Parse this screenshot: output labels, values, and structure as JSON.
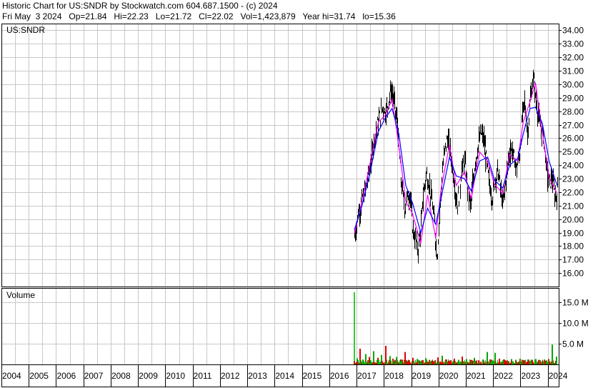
{
  "header": {
    "line1": "Historic Chart for US:SNDR by Stockwatch.com 604.687.1500 - (c) 2024",
    "line2": "Fri May  3 2024   Op=21.84   Hi=22.23   Lo=21.72   Cl=22.02   Vol=1,423,879   Year hi=31.74   lo=15.36"
  },
  "colors": {
    "background": "#ffffff",
    "grid": "#c8c8c8",
    "price_bars": "#000000",
    "ma_short": "#ff00ff",
    "ma_long": "#0000ff",
    "volume_up": "#00aa00",
    "volume_down": "#dd0000",
    "volume_spike": "#33cc33"
  },
  "chart_data": [
    {
      "type": "line",
      "title": "US:SNDR",
      "ylim": [
        15.0,
        34.5
      ],
      "y_ticks": [
        "34.00",
        "33.00",
        "32.00",
        "31.00",
        "30.00",
        "29.00",
        "28.00",
        "27.00",
        "26.00",
        "25.00",
        "24.00",
        "23.00",
        "22.00",
        "21.00",
        "20.00",
        "19.00",
        "18.00",
        "17.00",
        "16.00"
      ],
      "x_ticks": [
        "2004",
        "2005",
        "2006",
        "2007",
        "2008",
        "2009",
        "2010",
        "2011",
        "2012",
        "2013",
        "2014",
        "2015",
        "2016",
        "2017",
        "2018",
        "2019",
        "2020",
        "2021",
        "2022",
        "2023",
        "2024"
      ],
      "x_range": [
        2004.0,
        2024.4
      ],
      "series": [
        {
          "name": "",
          "style": "price-bars",
          "x": [
            2016.92,
            2017.05,
            2017.2,
            2017.35,
            2017.5,
            2017.65,
            2017.8,
            2017.95,
            2018.05,
            2018.15,
            2018.25,
            2018.35,
            2018.45,
            2018.55,
            2018.65,
            2018.75,
            2018.85,
            2018.95,
            2019.05,
            2019.15,
            2019.25,
            2019.35,
            2019.45,
            2019.55,
            2019.65,
            2019.75,
            2019.85,
            2019.95,
            2020.05,
            2020.15,
            2020.25,
            2020.35,
            2020.45,
            2020.55,
            2020.65,
            2020.75,
            2020.85,
            2020.95,
            2021.05,
            2021.15,
            2021.25,
            2021.35,
            2021.45,
            2021.55,
            2021.65,
            2021.75,
            2021.85,
            2021.95,
            2022.05,
            2022.15,
            2022.25,
            2022.35,
            2022.45,
            2022.55,
            2022.65,
            2022.75,
            2022.85,
            2022.95,
            2023.05,
            2023.15,
            2023.25,
            2023.35,
            2023.45,
            2023.55,
            2023.65,
            2023.75,
            2023.85,
            2023.95,
            2024.05,
            2024.15,
            2024.25,
            2024.34
          ],
          "y": [
            18.7,
            20.5,
            21.4,
            22.5,
            24.2,
            26.0,
            27.3,
            28.4,
            27.8,
            28.6,
            29.6,
            28.8,
            27.4,
            25.2,
            22.4,
            20.9,
            21.6,
            22.0,
            19.4,
            18.4,
            17.8,
            19.7,
            21.8,
            23.4,
            22.6,
            21.2,
            19.4,
            17.2,
            21.0,
            24.0,
            25.6,
            25.9,
            24.8,
            23.1,
            21.2,
            21.8,
            23.6,
            24.3,
            22.4,
            21.0,
            22.6,
            24.4,
            25.5,
            26.4,
            25.8,
            24.3,
            22.7,
            21.6,
            22.8,
            24.0,
            22.5,
            21.0,
            22.8,
            24.6,
            25.4,
            24.6,
            23.7,
            24.8,
            27.4,
            28.8,
            26.3,
            28.9,
            30.4,
            29.2,
            27.7,
            26.5,
            25.7,
            23.6,
            22.6,
            23.1,
            21.6,
            22.0
          ]
        },
        {
          "name": "",
          "style": "ma-short",
          "x": [
            2016.92,
            2017.2,
            2017.5,
            2017.8,
            2018.05,
            2018.3,
            2018.55,
            2018.8,
            2019.05,
            2019.35,
            2019.6,
            2019.9,
            2020.1,
            2020.4,
            2020.65,
            2020.95,
            2021.2,
            2021.5,
            2021.8,
            2022.05,
            2022.35,
            2022.6,
            2022.9,
            2023.1,
            2023.35,
            2023.55,
            2023.8,
            2024.05,
            2024.34
          ],
          "y": [
            18.9,
            21.3,
            24.2,
            27.2,
            27.7,
            28.9,
            25.4,
            21.3,
            20.4,
            18.2,
            21.8,
            18.6,
            22.3,
            25.5,
            22.5,
            23.5,
            21.5,
            25.0,
            24.3,
            22.6,
            21.9,
            24.8,
            24.3,
            27.2,
            28.7,
            30.1,
            26.4,
            23.1,
            21.9
          ]
        },
        {
          "name": "",
          "style": "ma-long",
          "x": [
            2016.92,
            2017.2,
            2017.5,
            2017.8,
            2018.05,
            2018.3,
            2018.55,
            2018.8,
            2019.05,
            2019.35,
            2019.6,
            2019.9,
            2020.1,
            2020.4,
            2020.65,
            2020.95,
            2021.2,
            2021.5,
            2021.8,
            2022.05,
            2022.35,
            2022.6,
            2022.9,
            2023.1,
            2023.35,
            2023.55,
            2023.8,
            2024.05,
            2024.34
          ],
          "y": [
            19.2,
            21.0,
            23.5,
            26.5,
            27.5,
            28.2,
            26.3,
            22.5,
            21.2,
            19.0,
            20.8,
            19.6,
            21.6,
            24.6,
            23.2,
            23.0,
            22.1,
            24.3,
            24.6,
            22.9,
            22.3,
            24.0,
            24.5,
            26.3,
            28.2,
            28.3,
            27.1,
            24.3,
            22.5
          ]
        }
      ]
    },
    {
      "type": "bar",
      "title": "Volume",
      "ylim": [
        0,
        18.5
      ],
      "y_ticks": [
        "15.0 M",
        "10.0 M",
        "5.0 M"
      ],
      "series": [
        {
          "name": "",
          "x": [
            2016.9,
            2017.0,
            2017.1,
            2017.2,
            2017.3,
            2017.45,
            2017.6,
            2017.75,
            2017.9,
            2018.05,
            2018.2,
            2018.3,
            2018.45,
            2018.6,
            2018.75,
            2018.9,
            2019.05,
            2019.2,
            2019.35,
            2019.5,
            2019.65,
            2019.8,
            2019.95,
            2020.1,
            2020.25,
            2020.4,
            2020.55,
            2020.7,
            2020.85,
            2021.0,
            2021.15,
            2021.3,
            2021.45,
            2021.6,
            2021.75,
            2021.9,
            2022.05,
            2022.2,
            2022.35,
            2022.5,
            2022.65,
            2022.8,
            2022.95,
            2023.1,
            2023.25,
            2023.4,
            2023.55,
            2023.7,
            2023.85,
            2024.0,
            2024.15,
            2024.3
          ],
          "values": [
            17.5,
            1.5,
            3.8,
            1.2,
            2.5,
            1.8,
            3.2,
            1.6,
            2.3,
            4.5,
            2.0,
            1.4,
            1.8,
            1.2,
            3.0,
            1.0,
            1.6,
            1.3,
            0.9,
            1.5,
            1.1,
            0.8,
            1.7,
            2.1,
            1.2,
            1.0,
            1.4,
            1.1,
            1.9,
            1.3,
            1.1,
            1.6,
            1.0,
            1.2,
            3.0,
            1.2,
            2.8,
            1.4,
            1.2,
            1.0,
            1.3,
            1.1,
            1.4,
            1.0,
            1.2,
            1.1,
            1.3,
            1.0,
            1.2,
            1.3,
            4.8,
            1.9
          ],
          "up": [
            true,
            true,
            false,
            true,
            true,
            false,
            true,
            false,
            true,
            false,
            true,
            false,
            true,
            false,
            false,
            true,
            false,
            true,
            false,
            true,
            false,
            true,
            false,
            true,
            false,
            true,
            false,
            true,
            false,
            true,
            false,
            true,
            false,
            true,
            true,
            false,
            true,
            false,
            true,
            false,
            true,
            false,
            true,
            false,
            true,
            false,
            true,
            false,
            true,
            false,
            true,
            true
          ]
        }
      ]
    }
  ]
}
